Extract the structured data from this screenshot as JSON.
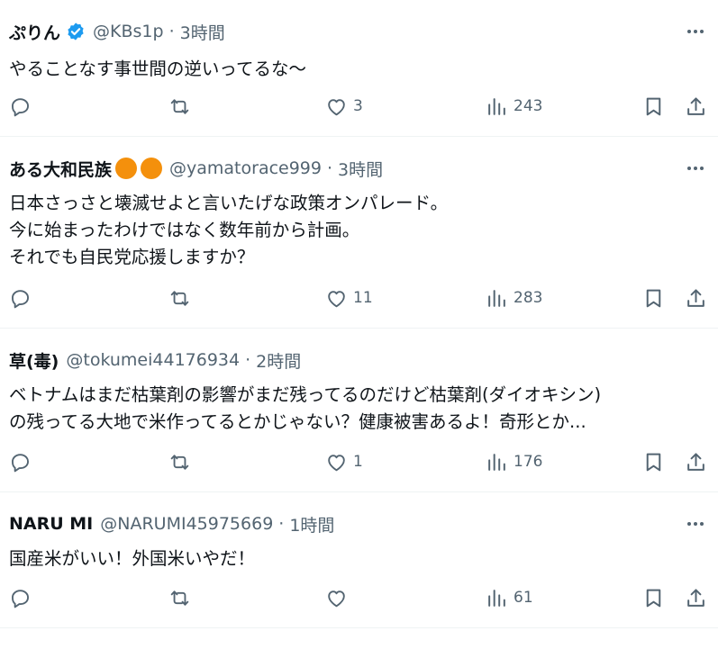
{
  "posts": [
    {
      "display_name": "ぷりん",
      "verified": true,
      "handle": "@KBs1p",
      "separator": "·",
      "time": "3時間",
      "lines": [
        "やることなす事世間の逆いってるな〜"
      ],
      "reply_count": "",
      "repost_count": "",
      "like_count": "3",
      "view_count": "243"
    },
    {
      "display_name": "ある大和民族",
      "emoji": "orange-circle-emoji",
      "handle": "@yamatorace999",
      "separator": "·",
      "time": "3時間",
      "lines": [
        "日本さっさと壊滅せよと言いたげな政策オンパレード。",
        "今に始まったわけではなく数年前から計画。",
        "それでも自民党応援しますか？"
      ],
      "reply_count": "",
      "repost_count": "",
      "like_count": "11",
      "view_count": "283"
    },
    {
      "display_name": "草(毒)",
      "handle": "@tokumei44176934",
      "separator": "·",
      "time": "2時間",
      "lines": [
        "ベトナムはまだ枯葉剤の影響がまだ残ってるのだけど枯葉剤(ダイオキシン)",
        "の残ってる大地で米作ってるとかじゃない？健康被害あるよ！奇形とか..."
      ],
      "reply_count": "",
      "repost_count": "",
      "like_count": "1",
      "view_count": "176"
    },
    {
      "display_name": "NARU MI",
      "handle": "@NARUMI45975669",
      "separator": "·",
      "time": "1時間",
      "lines": [
        "国産米がいい！外国米いやだ！"
      ],
      "reply_count": "",
      "repost_count": "",
      "like_count": "",
      "view_count": "61"
    }
  ],
  "icons": {
    "reply": "reply-icon",
    "repost": "repost-icon",
    "like": "heart-icon",
    "views": "views-icon",
    "bookmark": "bookmark-icon",
    "share": "share-icon",
    "more": "more-icon",
    "verified": "verified-badge-icon"
  },
  "colors": {
    "text": "#0f1419",
    "secondary": "#536471",
    "verified": "#1d9bf0",
    "divider": "#eff3f4",
    "emoji": "#f4900c"
  }
}
